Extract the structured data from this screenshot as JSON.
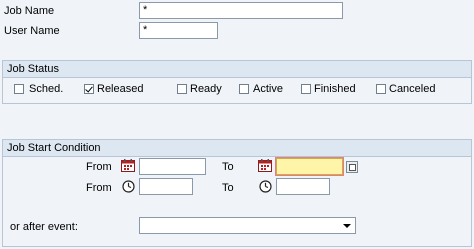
{
  "header_fields": {
    "job_name": {
      "label": "Job Name",
      "value": "*"
    },
    "user_name": {
      "label": "User Name",
      "value": "*"
    }
  },
  "job_status": {
    "title": "Job Status",
    "options": [
      {
        "label": "Sched.",
        "checked": false
      },
      {
        "label": "Released",
        "checked": true
      },
      {
        "label": "Ready",
        "checked": false
      },
      {
        "label": "Active",
        "checked": false
      },
      {
        "label": "Finished",
        "checked": false
      },
      {
        "label": "Canceled",
        "checked": false
      }
    ]
  },
  "start_condition": {
    "title": "Job Start Condition",
    "from_label": "From",
    "to_label": "To",
    "from_date": "",
    "to_date": "",
    "from_time": "",
    "to_time": "",
    "after_event_label": "or after event:",
    "after_event_value": ""
  },
  "icons": {
    "calendar": "calendar-icon",
    "clock": "clock-icon",
    "value_help": "value-help-icon",
    "dropdown": "chevron-down-icon"
  }
}
